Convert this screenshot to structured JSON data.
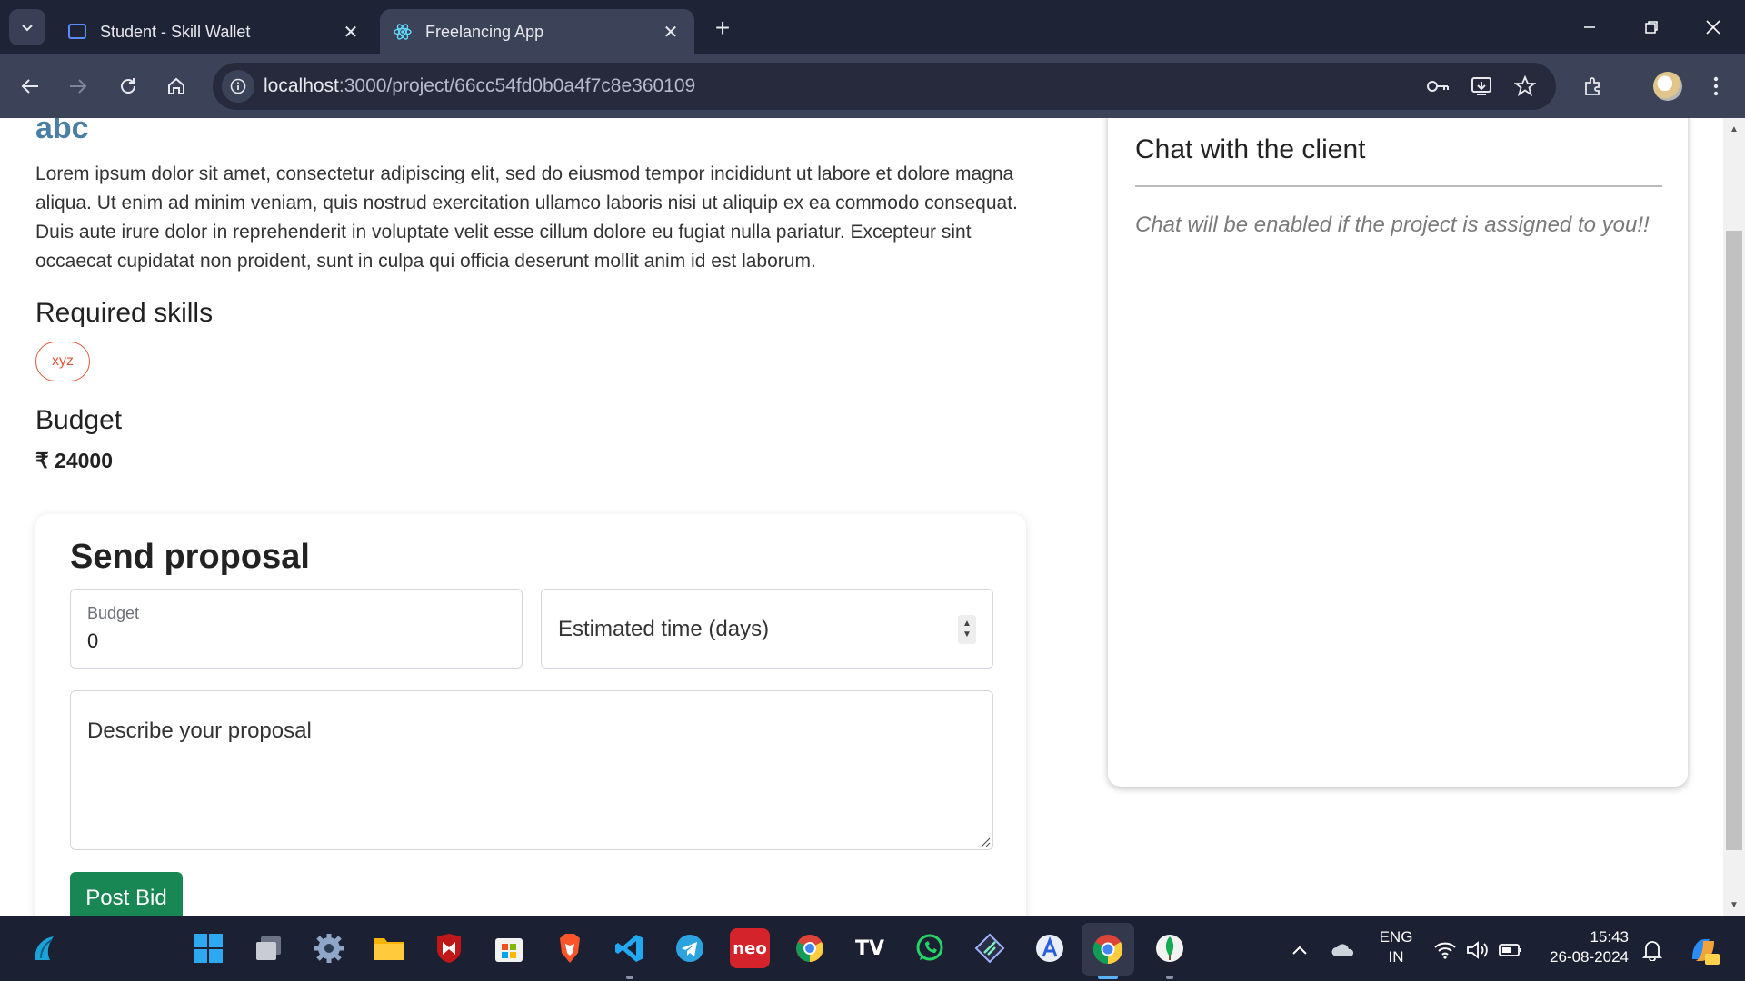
{
  "browser": {
    "tabs": [
      {
        "title": "Student - Skill Wallet",
        "favicon": "monitor-icon",
        "active": false
      },
      {
        "title": "Freelancing App",
        "favicon": "react-icon",
        "active": true
      }
    ],
    "url": {
      "host": "localhost",
      "path": ":3000/project/66cc54fd0b0a4f7c8e360109"
    }
  },
  "project": {
    "title": "abc",
    "description": "Lorem ipsum dolor sit amet, consectetur adipiscing elit, sed do eiusmod tempor incididunt ut labore et dolore magna aliqua. Ut enim ad minim veniam, quis nostrud exercitation ullamco laboris nisi ut aliquip ex ea commodo consequat. Duis aute irure dolor in reprehenderit in voluptate velit esse cillum dolore eu fugiat nulla pariatur. Excepteur sint occaecat cupidatat non proident, sunt in culpa qui officia deserunt mollit anim id est laborum.",
    "skills_heading": "Required skills",
    "skills": [
      "xyz"
    ],
    "budget_heading": "Budget",
    "budget_value": "₹ 24000"
  },
  "proposal": {
    "title": "Send proposal",
    "budget_label": "Budget",
    "budget_value": "0",
    "time_placeholder": "Estimated time (days)",
    "desc_placeholder": "Describe your proposal",
    "submit_label": "Post Bid",
    "submit_color": "#198754"
  },
  "chat": {
    "title": "Chat with the client",
    "note": "Chat will be enabled if the project is assigned to you!!"
  },
  "taskbar": {
    "language": "ENG",
    "region": "IN",
    "time": "15:43",
    "date": "26-08-2024",
    "neo_label": "neo",
    "tradingview_label": "TV"
  },
  "colors": {
    "accent_title": "#4a7fa3",
    "chip": "#dc5a3b"
  }
}
